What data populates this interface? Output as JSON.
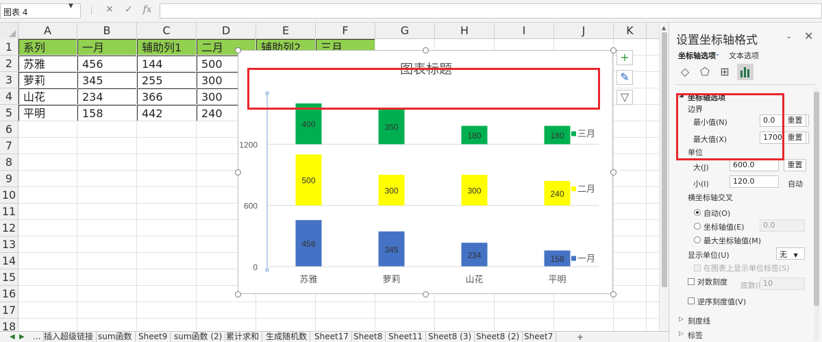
{
  "formula_bar": {
    "name_box": "图表 4",
    "cancel_glyph": "✕",
    "confirm_glyph": "✓",
    "fx_label": "fx",
    "formula": ""
  },
  "columns": [
    "A",
    "B",
    "C",
    "D",
    "E",
    "F",
    "G",
    "H",
    "I",
    "J",
    "K"
  ],
  "rows": [
    "1",
    "2",
    "3",
    "4",
    "5",
    "6",
    "7",
    "8",
    "9",
    "10",
    "11",
    "12",
    "13",
    "14",
    "15",
    "16",
    "17",
    "18"
  ],
  "table": {
    "header": [
      "系列",
      "一月",
      "辅助列1",
      "二月",
      "辅助列2",
      "三月"
    ],
    "rows": [
      [
        "苏雅",
        "456",
        "144",
        "500"
      ],
      [
        "萝莉",
        "345",
        "255",
        "300"
      ],
      [
        "山花",
        "234",
        "366",
        "300"
      ],
      [
        "平明",
        "158",
        "442",
        "240"
      ]
    ]
  },
  "chart_data": {
    "type": "bar",
    "stacked": true,
    "title": "图表标题",
    "categories": [
      "苏雅",
      "萝莉",
      "山花",
      "平明"
    ],
    "series": [
      {
        "name": "一月",
        "values": [
          456,
          345,
          234,
          158
        ],
        "color": "#4472c4",
        "label_color": "#333333"
      },
      {
        "name": "辅助列1",
        "values": [
          144,
          255,
          366,
          442
        ],
        "color": "transparent"
      },
      {
        "name": "二月",
        "values": [
          500,
          300,
          300,
          240
        ],
        "color": "#ffff00",
        "label_color": "#333333"
      },
      {
        "name": "辅助列2",
        "values": [
          100,
          300,
          300,
          360
        ],
        "color": "transparent"
      },
      {
        "name": "三月",
        "values": [
          400,
          350,
          180,
          180
        ],
        "color": "#00b050",
        "label_color": "#333333"
      }
    ],
    "legend": [
      "三月",
      "二月",
      "一月"
    ],
    "y_ticks": [
      "0",
      "600",
      "1200"
    ],
    "ylim": [
      0,
      1700
    ],
    "major_unit": 600,
    "legend_position": "right",
    "grid": true
  },
  "chart_buttons": [
    "+",
    "✎",
    "▽"
  ],
  "sheet_tabs": [
    "...",
    "插入超级链接",
    "sum函数",
    "Sheet9",
    "sum函数 (2)",
    "累计求和",
    "生成随机数",
    "Sheet17",
    "Sheet8",
    "Sheet11",
    "Sheet8 (3)",
    "Sheet8 (2)",
    "Sheet7"
  ],
  "tab_nav": {
    "left": "◀",
    "right": "▶",
    "add": "+"
  },
  "pane": {
    "title": "设置坐标轴格式",
    "close": "✕",
    "collapse": "⌄",
    "tabs": {
      "axis_options": "坐标轴选项",
      "text_options": "文本选项"
    },
    "section": "坐标轴选项",
    "bounds_label": "边界",
    "min_label": "最小值(N)",
    "min_value": "0.0",
    "max_label": "最大值(X)",
    "max_value": "1700.0",
    "reset": "重置",
    "units_label": "单位",
    "major_label": "大(J)",
    "major_value": "600.0",
    "minor_label": "小(I)",
    "minor_value": "120.0",
    "auto": "自动",
    "cross_label": "横坐标轴交叉",
    "cross_auto": "自动(O)",
    "cross_value_label": "坐标轴值(E)",
    "cross_value": "0.0",
    "cross_max": "最大坐标轴值(M)",
    "display_units_label": "显示单位(U)",
    "display_units_value": "无",
    "show_units_label": "在图表上显示单位标签(S)",
    "log_label": "对数刻度",
    "base_label": "底数(B)",
    "base_value": "10",
    "reverse_label": "逆序刻度值(V)",
    "tick_marks": "刻度线",
    "labels": "标签"
  }
}
